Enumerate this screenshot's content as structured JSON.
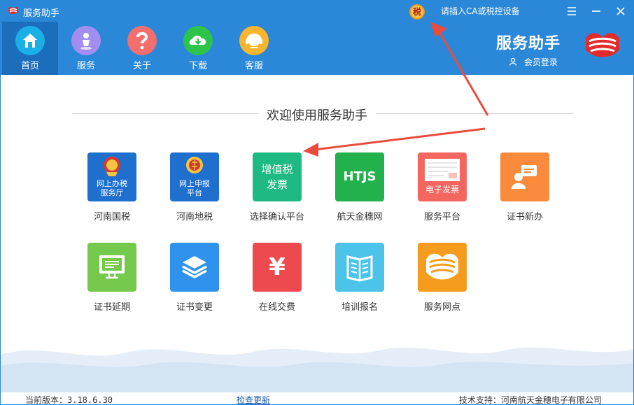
{
  "window": {
    "title": "服务助手",
    "tax_badge": "税",
    "device_status": "请插入CA或税控设备"
  },
  "nav": {
    "items": [
      {
        "label": "首页",
        "icon": "home-icon",
        "color": "#1ab0e6"
      },
      {
        "label": "服务",
        "icon": "person-icon",
        "color": "#a28ef0"
      },
      {
        "label": "关于",
        "icon": "question-icon",
        "color": "#f46e6e"
      },
      {
        "label": "下载",
        "icon": "download-cloud-icon",
        "color": "#2ec44b"
      },
      {
        "label": "客服",
        "icon": "headset-icon",
        "color": "#f8b52d"
      }
    ]
  },
  "brand": {
    "title": "服务助手",
    "login": "会员登录"
  },
  "welcome": {
    "title": "欢迎使用服务助手"
  },
  "tiles": [
    {
      "label": "河南国税",
      "caption": "网上办税\n服务厅",
      "icon": "national-tax-emblem-icon",
      "color": "#1e6fce"
    },
    {
      "label": "河南地税",
      "caption": "网上申报\n平台",
      "icon": "local-tax-emblem-icon",
      "color": "#1e6fce"
    },
    {
      "label": "选择确认平台",
      "caption": "增值税\n发票",
      "icon": "vat-invoice-icon",
      "color": "#1fba83"
    },
    {
      "label": "航天金穗网",
      "caption": "HTJS",
      "icon": "htjs-logo-icon",
      "color": "#22b14c"
    },
    {
      "label": "服务平台",
      "caption": "电子发票",
      "icon": "e-invoice-icon",
      "color": "#f46660"
    },
    {
      "label": "证书新办",
      "caption": "",
      "icon": "certificate-new-icon",
      "color": "#fa8a3c"
    },
    {
      "label": "证书延期",
      "caption": "",
      "icon": "certificate-extend-icon",
      "color": "#75c94c"
    },
    {
      "label": "证书变更",
      "caption": "",
      "icon": "layers-icon",
      "color": "#2f93ee"
    },
    {
      "label": "在线交费",
      "caption": "¥",
      "icon": "yen-icon",
      "color": "#ec4a4f"
    },
    {
      "label": "培训报名",
      "caption": "",
      "icon": "book-icon",
      "color": "#4cc3e8"
    },
    {
      "label": "服务网点",
      "caption": "",
      "icon": "service-point-icon",
      "color": "#f59b1d"
    }
  ],
  "status": {
    "version": "当前版本：3.18.6.30",
    "check_update": "检查更新",
    "tech_support": "技术支持：河南航天金穗电子有限公司"
  },
  "colors": {
    "header": "#2b88d8",
    "active_nav": "#1c6dbc",
    "annotation_arrow": "#e84c3d"
  }
}
